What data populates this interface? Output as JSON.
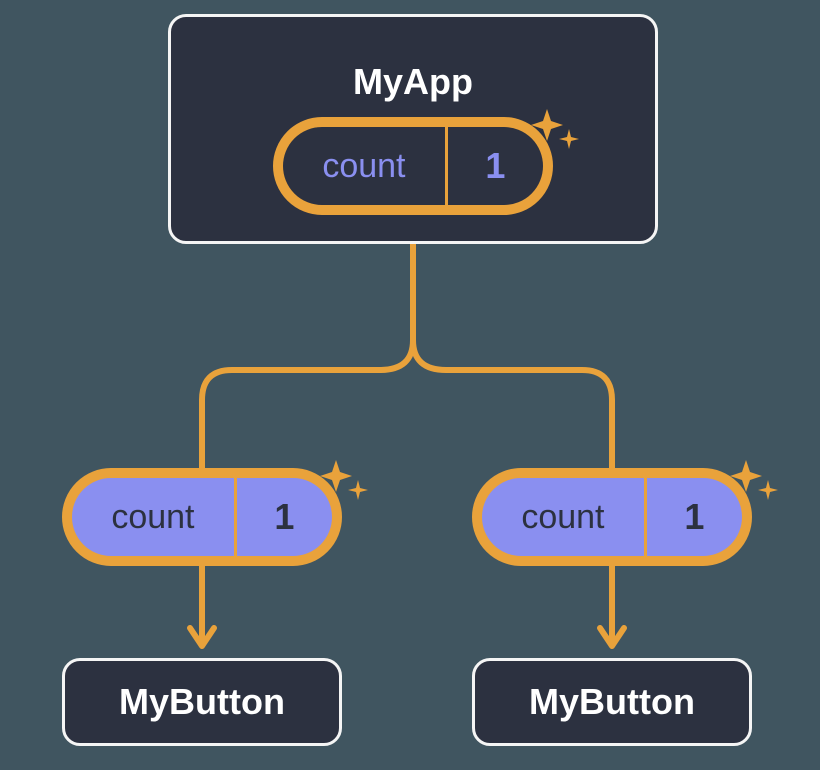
{
  "colors": {
    "background": "#405560",
    "node_bg": "#2c3140",
    "node_border": "#f5f5f5",
    "accent_orange": "#e9a23b",
    "accent_purple": "#8a8ff0"
  },
  "parent": {
    "title": "MyApp",
    "state_label": "count",
    "state_value": "1"
  },
  "children": [
    {
      "prop_label": "count",
      "prop_value": "1",
      "title": "MyButton"
    },
    {
      "prop_label": "count",
      "prop_value": "1",
      "title": "MyButton"
    }
  ]
}
